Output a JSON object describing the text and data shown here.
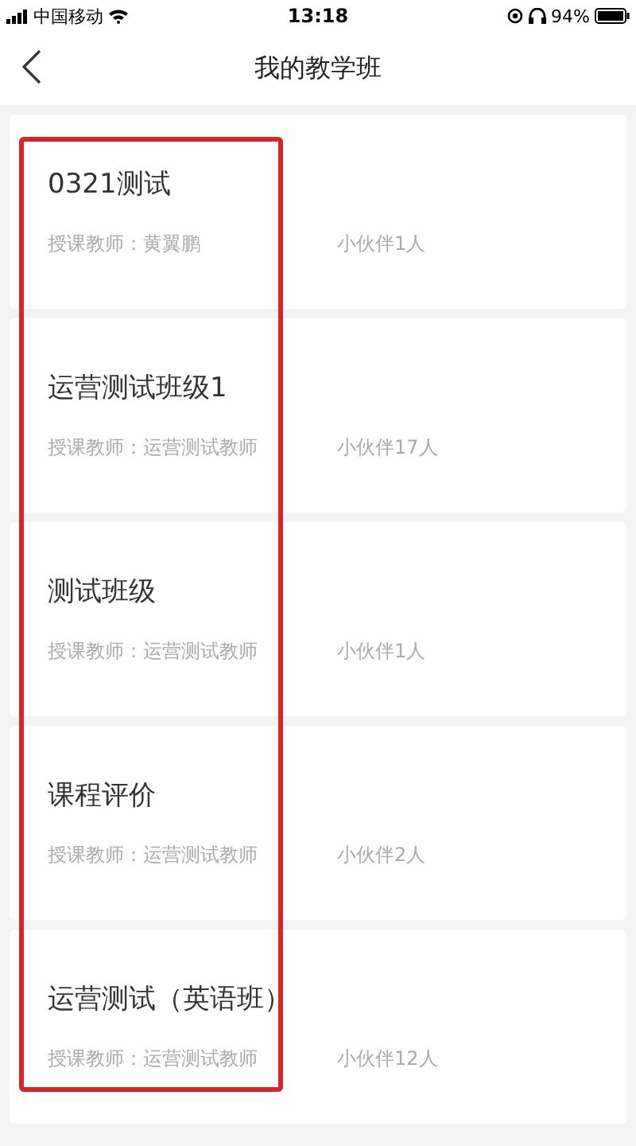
{
  "status_bar": {
    "carrier": "中国移动",
    "time": "13:18",
    "battery": "94%"
  },
  "nav": {
    "title": "我的教学班"
  },
  "classes": [
    {
      "name": "0321测试",
      "teacher": "授课教师：黄翼鹏",
      "members": "小伙伴1人"
    },
    {
      "name": "运营测试班级1",
      "teacher": "授课教师：运营测试教师",
      "members": "小伙伴17人"
    },
    {
      "name": "测试班级",
      "teacher": "授课教师：运营测试教师",
      "members": "小伙伴1人"
    },
    {
      "name": "课程评价",
      "teacher": "授课教师：运营测试教师",
      "members": "小伙伴2人"
    },
    {
      "name": "运营测试（英语班）",
      "teacher": "授课教师：运营测试教师",
      "members": "小伙伴12人"
    }
  ]
}
